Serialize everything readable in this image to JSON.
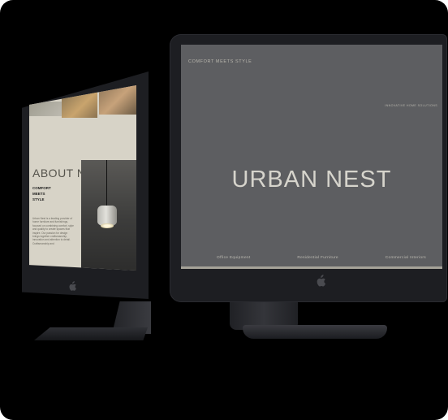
{
  "right_screen": {
    "tagline_left": "COMFORT MEETS STYLE",
    "tagline_right": "INNOVATIVE HOME SOLUTIONS",
    "title": "URBAN NEST",
    "nav": [
      "Office Equipment",
      "Residential Furniture",
      "Commercial Interiors"
    ]
  },
  "left_screen": {
    "title": "ABOUT NEST",
    "subtitle": "COMFORT\nMEETS\nSTYLE",
    "body": "Urban Nest is a leading provider of home furniture and furnishings, focused on combining comfort, style and quality to create spaces that inspire. Our passion for design brings together craftsmanship, innovation and attention to detail. Craftsmanship and"
  },
  "colors": {
    "background": "#000000",
    "right_screen_bg": "#5d5e61",
    "left_screen_bg": "#d7d3c7",
    "bezel": "#1d1e22"
  },
  "icons": [
    "apple-logo-icon"
  ]
}
